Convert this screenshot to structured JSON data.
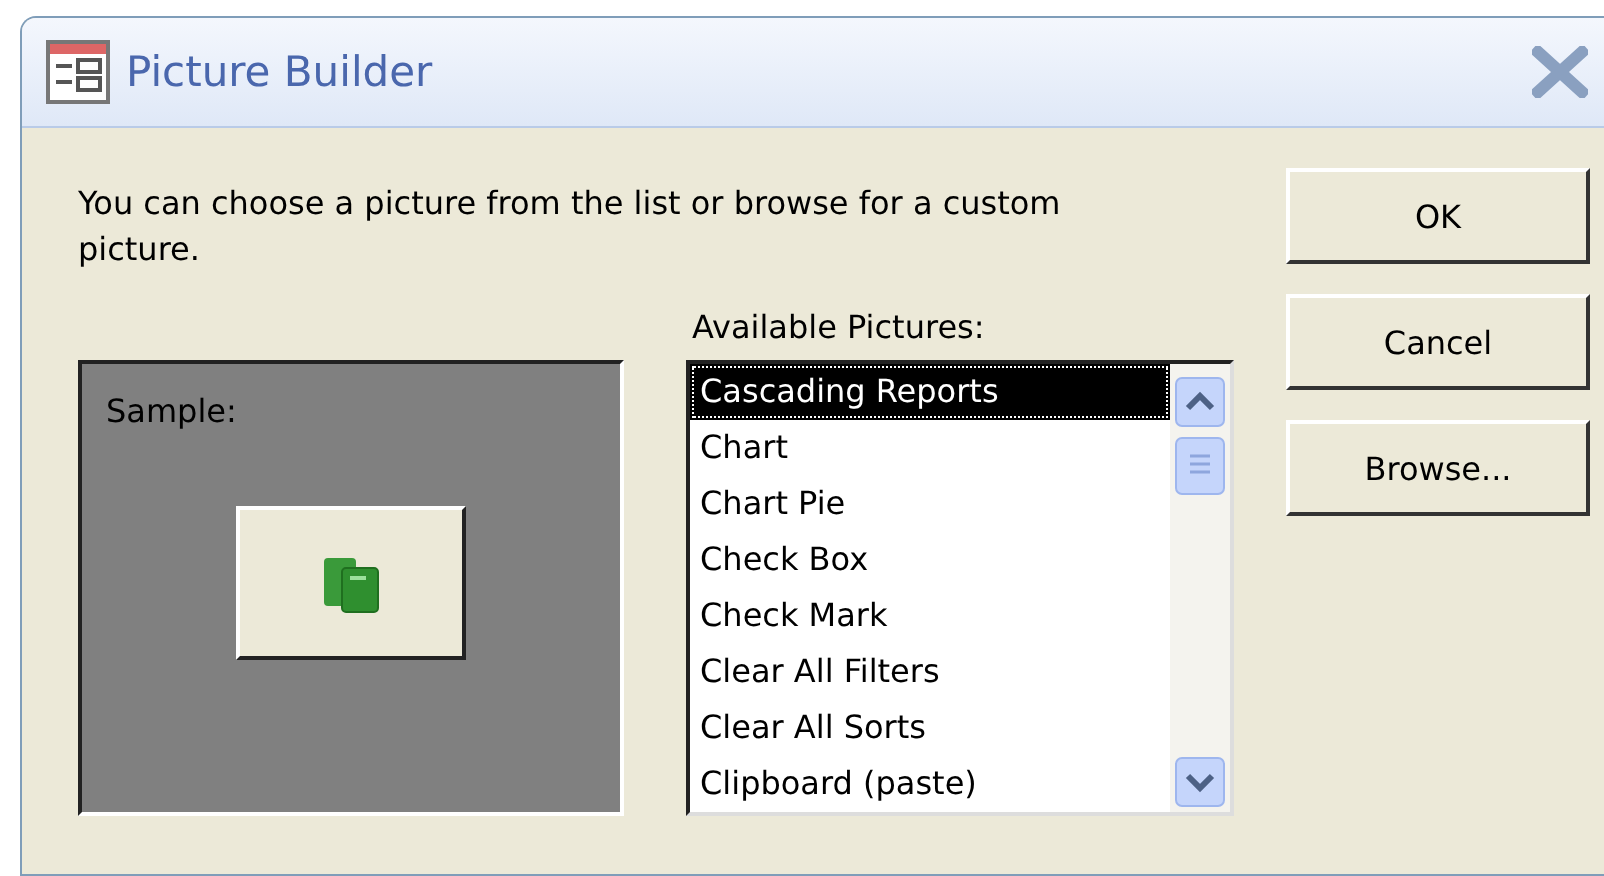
{
  "window": {
    "title": "Picture Builder"
  },
  "description": "You can choose a picture from the list or browse for a custom picture.",
  "sample": {
    "label": "Sample:"
  },
  "list": {
    "label": "Available Pictures:",
    "items": [
      {
        "text": "Cascading Reports",
        "selected": true
      },
      {
        "text": "Chart",
        "selected": false
      },
      {
        "text": "Chart Pie",
        "selected": false
      },
      {
        "text": "Check Box",
        "selected": false
      },
      {
        "text": "Check Mark",
        "selected": false
      },
      {
        "text": "Clear All Filters",
        "selected": false
      },
      {
        "text": "Clear All Sorts",
        "selected": false
      },
      {
        "text": "Clipboard (paste)",
        "selected": false
      }
    ]
  },
  "buttons": [
    "OK",
    "Cancel",
    "Browse..."
  ]
}
